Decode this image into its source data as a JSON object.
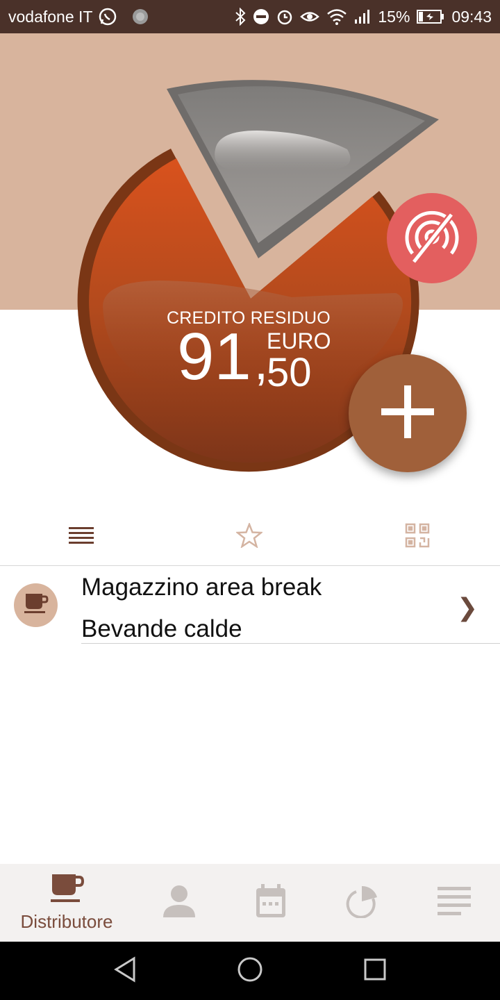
{
  "status_bar": {
    "carrier": "vodafone IT",
    "battery": "15%",
    "time": "09:43"
  },
  "hero": {
    "credit_label": "CREDITO RESIDUO",
    "credit_integer": "91",
    "credit_comma": ",",
    "credit_decimals": "50",
    "currency": "EURO",
    "accent": "#a0603a",
    "nfc_color": "#e35f5f"
  },
  "tabs": [
    {
      "icon": "list-icon"
    },
    {
      "icon": "star-icon"
    },
    {
      "icon": "qr-code-icon"
    }
  ],
  "list": {
    "items": [
      {
        "title": "Magazzino area break",
        "subtitle": "Bevande calde",
        "icon": "coffee-cup-icon"
      }
    ]
  },
  "bottom_nav": {
    "items": [
      {
        "label": "Distributore",
        "icon": "coffee-cup-icon",
        "active": true
      },
      {
        "label": "",
        "icon": "user-icon"
      },
      {
        "label": "",
        "icon": "calendar-icon"
      },
      {
        "label": "",
        "icon": "pie-chart-icon"
      },
      {
        "label": "",
        "icon": "menu-icon"
      }
    ]
  }
}
